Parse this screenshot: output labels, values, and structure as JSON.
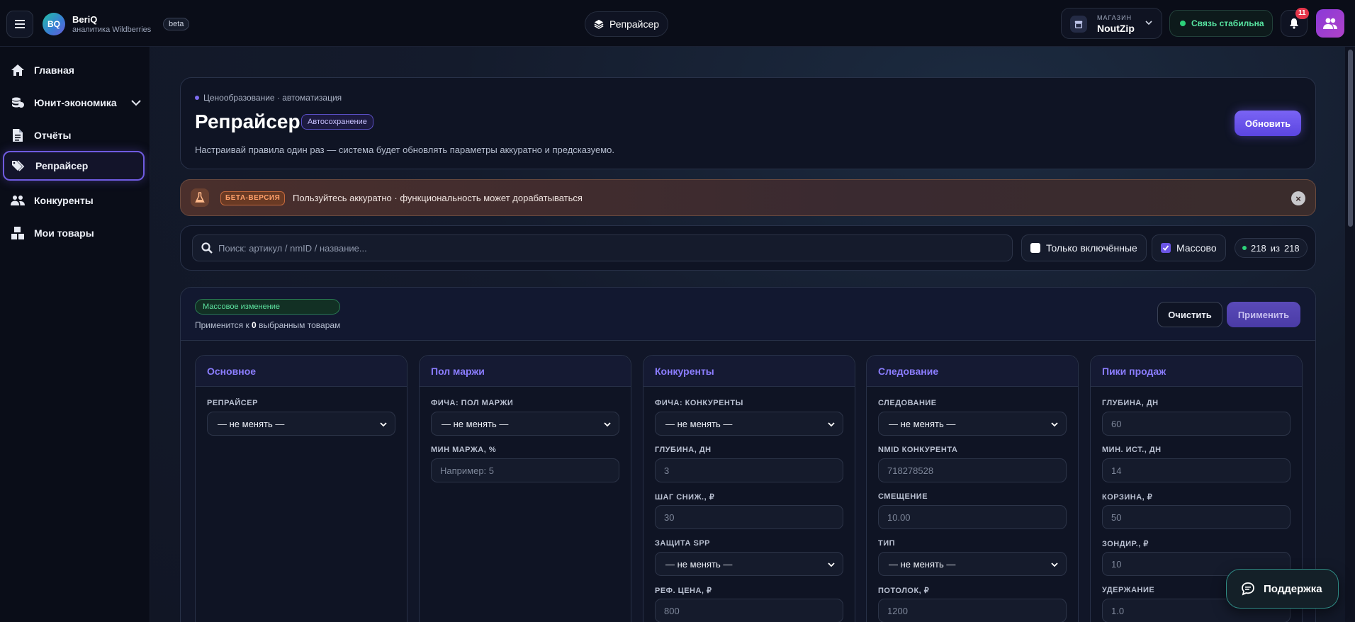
{
  "header": {
    "brand_initials": "BQ",
    "brand_name": "BeriQ",
    "brand_sub": "аналитика Wildberries",
    "beta_label": "beta",
    "page_chip": "Репрайсер",
    "store_label": "МАГАЗИН",
    "store_name": "NoutZip",
    "connection": "Связь стабильна",
    "notifications_count": "11"
  },
  "sidebar": {
    "items": [
      {
        "label": "Главная",
        "icon": "home-icon"
      },
      {
        "label": "Юнит-экономика",
        "icon": "coins-icon"
      },
      {
        "label": "Отчёты",
        "icon": "report-icon"
      },
      {
        "label": "Репрайсер",
        "icon": "tags-icon",
        "active": true
      },
      {
        "label": "Конкуренты",
        "icon": "users-icon"
      },
      {
        "label": "Мои товары",
        "icon": "boxes-icon"
      }
    ]
  },
  "hero": {
    "kicker": "Ценообразование · автоматизация",
    "title": "Репрайсер",
    "autosave": "Автосохранение",
    "description": "Настраивай правила один раз — система будет обновлять параметры аккуратно и предсказуемо.",
    "update_button": "Обновить"
  },
  "beta_banner": {
    "tag": "БЕТА-ВЕРСИЯ",
    "text": "Пользуйтесь аккуратно · функциональность может дорабатываться"
  },
  "filters": {
    "search_placeholder": "Поиск: артикул / nmID / название...",
    "only_enabled": "Только включённые",
    "only_enabled_checked": false,
    "mass": "Массово",
    "mass_checked": true,
    "count_shown": "218",
    "count_of": "из",
    "count_total": "218"
  },
  "mass_edit": {
    "tag": "Массовое изменение",
    "applies_prefix": "Применится к",
    "applies_count": "0",
    "applies_suffix": "выбранным товарам",
    "clear_button": "Очистить",
    "apply_button": "Применить"
  },
  "panels": [
    {
      "title": "Основное",
      "fields": [
        {
          "label": "РЕПРАЙСЕР",
          "type": "select",
          "value": "— не менять —"
        }
      ]
    },
    {
      "title": "Пол маржи",
      "fields": [
        {
          "label": "ФИЧА: ПОЛ МАРЖИ",
          "type": "select",
          "value": "— не менять —"
        },
        {
          "label": "МИН МАРЖА, %",
          "type": "input",
          "value": "Например: 5"
        }
      ]
    },
    {
      "title": "Конкуренты",
      "fields": [
        {
          "label": "ФИЧА: КОНКУРЕНТЫ",
          "type": "select",
          "value": "— не менять —"
        },
        {
          "label": "ГЛУБИНА, ДН",
          "type": "input",
          "value": "3"
        },
        {
          "label": "ШАГ СНИЖ., ₽",
          "type": "input",
          "value": "30"
        },
        {
          "label": "ЗАЩИТА SPP",
          "type": "select",
          "value": "— не менять —"
        },
        {
          "label": "РЕФ. ЦЕНА, ₽",
          "type": "input",
          "value": "800"
        }
      ]
    },
    {
      "title": "Следование",
      "fields": [
        {
          "label": "СЛЕДОВАНИЕ",
          "type": "select",
          "value": "— не менять —"
        },
        {
          "label": "NMID КОНКУРЕНТА",
          "type": "input",
          "value": "718278528"
        },
        {
          "label": "СМЕЩЕНИЕ",
          "type": "input",
          "value": "10.00"
        },
        {
          "label": "ТИП",
          "type": "select",
          "value": "— не менять —"
        },
        {
          "label": "ПОТОЛОК, ₽",
          "type": "input",
          "value": "1200"
        }
      ]
    },
    {
      "title": "Пики продаж",
      "fields": [
        {
          "label": "ГЛУБИНА, ДН",
          "type": "input",
          "value": "60"
        },
        {
          "label": "МИН. ИСТ., ДН",
          "type": "input",
          "value": "14"
        },
        {
          "label": "КОРЗИНА, ₽",
          "type": "input",
          "value": "50"
        },
        {
          "label": "ЗОНДИР., ₽",
          "type": "input",
          "value": "10"
        },
        {
          "label": "УДЕРЖАНИЕ",
          "type": "input",
          "value": "1.0"
        }
      ]
    }
  ],
  "support_button": "Поддержка",
  "colors": {
    "accent": "#6b55e6",
    "panel_title": "#8b7dff",
    "success": "#2dd27a",
    "beta_orange": "#ffa06a"
  }
}
